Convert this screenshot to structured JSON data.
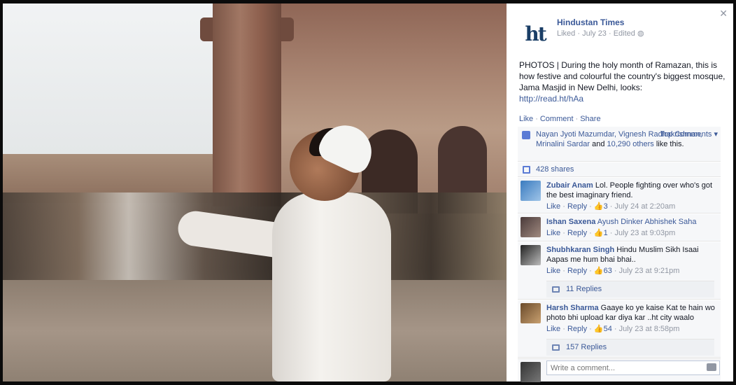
{
  "post": {
    "page_name": "Hindustan Times",
    "logo_text": "ht",
    "meta": "Liked · July 23 · Edited",
    "text": "PHOTOS | During the holy month of Ramazan, this is how festive and colourful the country's biggest mosque, Jama Masjid in New Delhi, looks:",
    "link": "http://read.ht/hAa"
  },
  "actions": {
    "like": "Like",
    "comment": "Comment",
    "share": "Share",
    "dot": "·"
  },
  "likes": {
    "names": "Nayan Jyoti Mazumdar, Vignesh Radhakrishnan, Mrinalini Sardar",
    "and": " and ",
    "others": "10,290 others",
    "suffix": " like this.",
    "top_comments": "Top Comments ▾"
  },
  "shares": "428 shares",
  "comments": [
    {
      "author": "Zubair Anam",
      "tag": "",
      "text": " Lol. People fighting over who's got the best imaginary friend.",
      "like": "Like",
      "reply": "Reply",
      "likes": "3",
      "time": "July 24 at 2:20am",
      "replies": ""
    },
    {
      "author": "Ishan Saxena",
      "tag": " Ayush Dinker Abhishek Saha",
      "text": "",
      "like": "Like",
      "reply": "Reply",
      "likes": "1",
      "time": "July 23 at 9:03pm",
      "replies": ""
    },
    {
      "author": "Shubhkaran Singh",
      "tag": "",
      "text": " Hindu Muslim Sikh Isaai Aapas me hum bhai bhai..",
      "like": "Like",
      "reply": "Reply",
      "likes": "63",
      "time": "July 23 at 9:21pm",
      "replies": "11 Replies"
    },
    {
      "author": "Harsh Sharma",
      "tag": "",
      "text": " Gaaye ko ye kaise Kat te hain wo photo bhi upload kar diya kar ..ht city waalo",
      "like": "Like",
      "reply": "Reply",
      "likes": "54",
      "time": "July 23 at 8:58pm",
      "replies": "157 Replies"
    }
  ],
  "write_comment": {
    "placeholder": "Write a comment..."
  },
  "icons": {
    "close": "close-icon",
    "camera": "camera-icon",
    "globe": "globe-icon",
    "thumb": "like-thumb-icon",
    "share": "share-icon",
    "reply": "reply-icon"
  },
  "colors": {
    "link": "#3b5998",
    "muted": "#9197a3",
    "ufi_bg": "#f6f7f9"
  }
}
